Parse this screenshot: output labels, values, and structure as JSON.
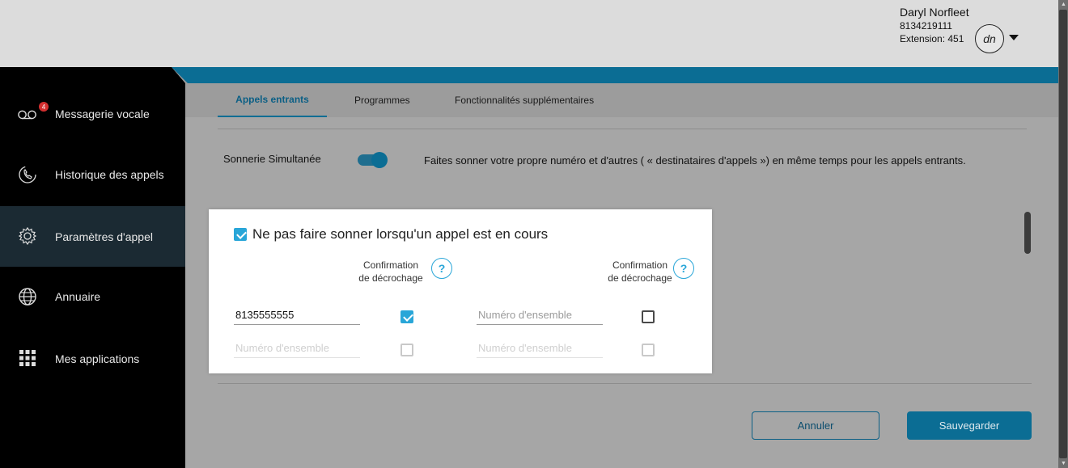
{
  "user": {
    "name": "Daryl Norfleet",
    "number": "8134219111",
    "extension": "Extension: 451",
    "initials": "dn"
  },
  "sidebar": {
    "voicemail_badge": "4",
    "items": [
      {
        "label": "Messagerie vocale",
        "icon": "voicemail-icon"
      },
      {
        "label": "Historique des appels",
        "icon": "phone-history-icon"
      },
      {
        "label": "Paramètres d'appel",
        "icon": "gear-icon",
        "active": true
      },
      {
        "label": "Annuaire",
        "icon": "globe-icon"
      },
      {
        "label": "Mes applications",
        "icon": "apps-grid-icon"
      }
    ]
  },
  "tabs": [
    {
      "label": "Appels entrants",
      "active": true
    },
    {
      "label": "Programmes"
    },
    {
      "label": "Fonctionnalités supplémentaires"
    }
  ],
  "simultaneous_ring": {
    "label": "Sonnerie Simultanée",
    "enabled": true,
    "description": "Faites sonner votre propre numéro et d'autres ( « destinataires d'appels ») en même temps pour les appels entrants."
  },
  "popup": {
    "dont_ring_label": "Ne pas faire sonner lorsqu'un appel est en cours",
    "dont_ring_checked": true,
    "col_header_1": "Confirmation de décrochage",
    "col_header_2": "Confirmation de décrochage",
    "help_symbol": "?",
    "rows": [
      {
        "left_value": "8135555555",
        "left_confirm": true,
        "right_placeholder": "Numéro d'ensemble",
        "right_confirm": false
      },
      {
        "left_placeholder": "Numéro d'ensemble",
        "left_confirm": false,
        "right_placeholder": "Numéro d'ensemble",
        "right_confirm": false
      }
    ]
  },
  "actions": {
    "cancel": "Annuler",
    "save": "Sauvegarder"
  },
  "colors": {
    "accent": "#0b6d94",
    "check": "#29a6d8",
    "badge": "#d32f2f"
  }
}
